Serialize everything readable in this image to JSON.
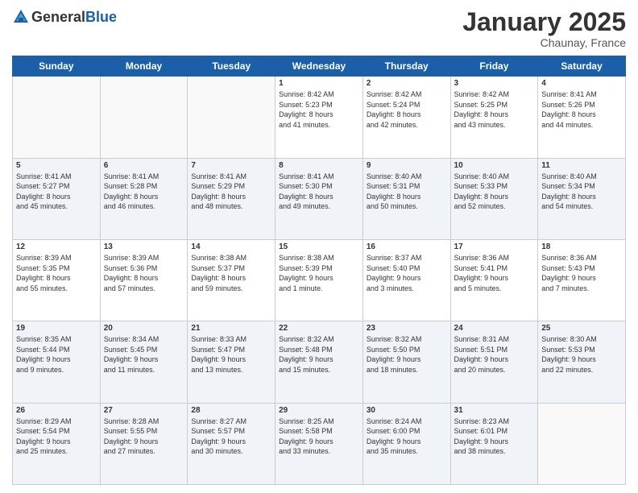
{
  "logo": {
    "general": "General",
    "blue": "Blue"
  },
  "title": "January 2025",
  "location": "Chaunay, France",
  "days_of_week": [
    "Sunday",
    "Monday",
    "Tuesday",
    "Wednesday",
    "Thursday",
    "Friday",
    "Saturday"
  ],
  "weeks": [
    [
      {
        "day": "",
        "info": ""
      },
      {
        "day": "",
        "info": ""
      },
      {
        "day": "",
        "info": ""
      },
      {
        "day": "1",
        "info": "Sunrise: 8:42 AM\nSunset: 5:23 PM\nDaylight: 8 hours\nand 41 minutes."
      },
      {
        "day": "2",
        "info": "Sunrise: 8:42 AM\nSunset: 5:24 PM\nDaylight: 8 hours\nand 42 minutes."
      },
      {
        "day": "3",
        "info": "Sunrise: 8:42 AM\nSunset: 5:25 PM\nDaylight: 8 hours\nand 43 minutes."
      },
      {
        "day": "4",
        "info": "Sunrise: 8:41 AM\nSunset: 5:26 PM\nDaylight: 8 hours\nand 44 minutes."
      }
    ],
    [
      {
        "day": "5",
        "info": "Sunrise: 8:41 AM\nSunset: 5:27 PM\nDaylight: 8 hours\nand 45 minutes."
      },
      {
        "day": "6",
        "info": "Sunrise: 8:41 AM\nSunset: 5:28 PM\nDaylight: 8 hours\nand 46 minutes."
      },
      {
        "day": "7",
        "info": "Sunrise: 8:41 AM\nSunset: 5:29 PM\nDaylight: 8 hours\nand 48 minutes."
      },
      {
        "day": "8",
        "info": "Sunrise: 8:41 AM\nSunset: 5:30 PM\nDaylight: 8 hours\nand 49 minutes."
      },
      {
        "day": "9",
        "info": "Sunrise: 8:40 AM\nSunset: 5:31 PM\nDaylight: 8 hours\nand 50 minutes."
      },
      {
        "day": "10",
        "info": "Sunrise: 8:40 AM\nSunset: 5:33 PM\nDaylight: 8 hours\nand 52 minutes."
      },
      {
        "day": "11",
        "info": "Sunrise: 8:40 AM\nSunset: 5:34 PM\nDaylight: 8 hours\nand 54 minutes."
      }
    ],
    [
      {
        "day": "12",
        "info": "Sunrise: 8:39 AM\nSunset: 5:35 PM\nDaylight: 8 hours\nand 55 minutes."
      },
      {
        "day": "13",
        "info": "Sunrise: 8:39 AM\nSunset: 5:36 PM\nDaylight: 8 hours\nand 57 minutes."
      },
      {
        "day": "14",
        "info": "Sunrise: 8:38 AM\nSunset: 5:37 PM\nDaylight: 8 hours\nand 59 minutes."
      },
      {
        "day": "15",
        "info": "Sunrise: 8:38 AM\nSunset: 5:39 PM\nDaylight: 9 hours\nand 1 minute."
      },
      {
        "day": "16",
        "info": "Sunrise: 8:37 AM\nSunset: 5:40 PM\nDaylight: 9 hours\nand 3 minutes."
      },
      {
        "day": "17",
        "info": "Sunrise: 8:36 AM\nSunset: 5:41 PM\nDaylight: 9 hours\nand 5 minutes."
      },
      {
        "day": "18",
        "info": "Sunrise: 8:36 AM\nSunset: 5:43 PM\nDaylight: 9 hours\nand 7 minutes."
      }
    ],
    [
      {
        "day": "19",
        "info": "Sunrise: 8:35 AM\nSunset: 5:44 PM\nDaylight: 9 hours\nand 9 minutes."
      },
      {
        "day": "20",
        "info": "Sunrise: 8:34 AM\nSunset: 5:45 PM\nDaylight: 9 hours\nand 11 minutes."
      },
      {
        "day": "21",
        "info": "Sunrise: 8:33 AM\nSunset: 5:47 PM\nDaylight: 9 hours\nand 13 minutes."
      },
      {
        "day": "22",
        "info": "Sunrise: 8:32 AM\nSunset: 5:48 PM\nDaylight: 9 hours\nand 15 minutes."
      },
      {
        "day": "23",
        "info": "Sunrise: 8:32 AM\nSunset: 5:50 PM\nDaylight: 9 hours\nand 18 minutes."
      },
      {
        "day": "24",
        "info": "Sunrise: 8:31 AM\nSunset: 5:51 PM\nDaylight: 9 hours\nand 20 minutes."
      },
      {
        "day": "25",
        "info": "Sunrise: 8:30 AM\nSunset: 5:53 PM\nDaylight: 9 hours\nand 22 minutes."
      }
    ],
    [
      {
        "day": "26",
        "info": "Sunrise: 8:29 AM\nSunset: 5:54 PM\nDaylight: 9 hours\nand 25 minutes."
      },
      {
        "day": "27",
        "info": "Sunrise: 8:28 AM\nSunset: 5:55 PM\nDaylight: 9 hours\nand 27 minutes."
      },
      {
        "day": "28",
        "info": "Sunrise: 8:27 AM\nSunset: 5:57 PM\nDaylight: 9 hours\nand 30 minutes."
      },
      {
        "day": "29",
        "info": "Sunrise: 8:25 AM\nSunset: 5:58 PM\nDaylight: 9 hours\nand 33 minutes."
      },
      {
        "day": "30",
        "info": "Sunrise: 8:24 AM\nSunset: 6:00 PM\nDaylight: 9 hours\nand 35 minutes."
      },
      {
        "day": "31",
        "info": "Sunrise: 8:23 AM\nSunset: 6:01 PM\nDaylight: 9 hours\nand 38 minutes."
      },
      {
        "day": "",
        "info": ""
      }
    ]
  ]
}
